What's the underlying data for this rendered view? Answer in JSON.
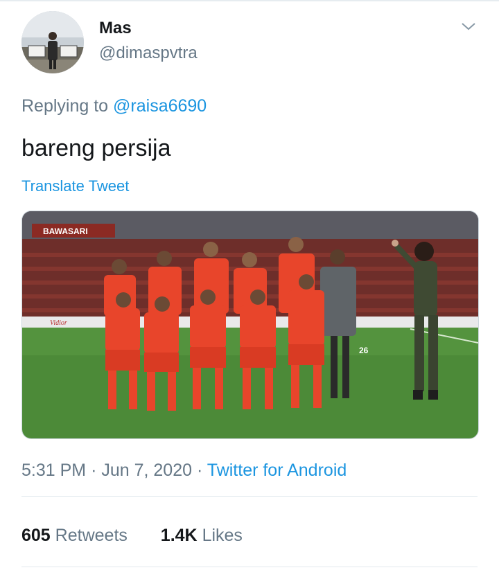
{
  "author": {
    "display_name": "Mas",
    "handle": "@dimaspvtra"
  },
  "reply": {
    "prefix": "Replying to",
    "mention": "@raisa6690"
  },
  "tweet": {
    "text": "bareng persija",
    "translate_label": "Translate Tweet"
  },
  "meta": {
    "time": "5:31 PM",
    "separator": "·",
    "date": "Jun 7, 2020",
    "source": "Twitter for Android"
  },
  "stats": {
    "retweets_count": "605",
    "retweets_label": "Retweets",
    "likes_count": "1.4K",
    "likes_label": "Likes"
  },
  "photo": {
    "banner_text": "BAWASARI",
    "board_text": "Vidior",
    "jersey_number": "26"
  },
  "colors": {
    "link": "#1b95e0",
    "secondary_text": "#657786",
    "primary_text": "#14171a",
    "jersey": "#e8452b",
    "pitch": "#4c8a38"
  },
  "icons": {
    "menu": "chevron-down-icon"
  }
}
